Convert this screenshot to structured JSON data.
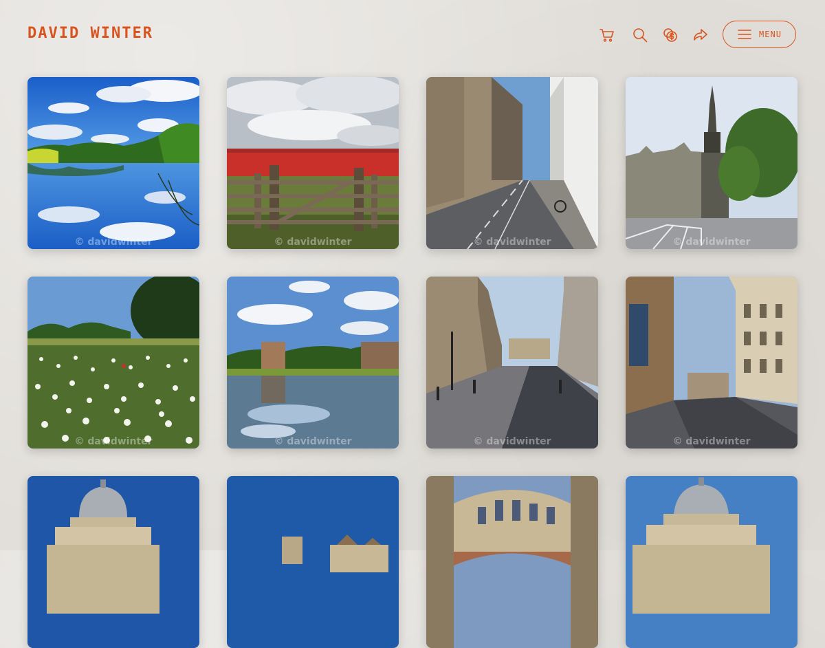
{
  "header": {
    "brand": "DAVID WINTER",
    "menu_label": "MENU",
    "icons": [
      "cart-icon",
      "search-icon",
      "currency-icon",
      "share-icon",
      "hamburger-icon"
    ]
  },
  "colors": {
    "accent": "#d9531e",
    "background": "#e2dfda"
  },
  "gallery": {
    "watermark": "© davidwinter",
    "photos": [
      {
        "subject": "lake-reflection"
      },
      {
        "subject": "poppy-field-gate"
      },
      {
        "subject": "narrow-street"
      },
      {
        "subject": "martyrs-memorial"
      },
      {
        "subject": "daisy-meadow"
      },
      {
        "subject": "pond-tower"
      },
      {
        "subject": "broad-street"
      },
      {
        "subject": "high-street-corner"
      },
      {
        "subject": "radcliffe-camera"
      },
      {
        "subject": "city-rooftops"
      },
      {
        "subject": "bridge-of-sighs"
      },
      {
        "subject": "radcliffe-camera-2"
      }
    ]
  }
}
